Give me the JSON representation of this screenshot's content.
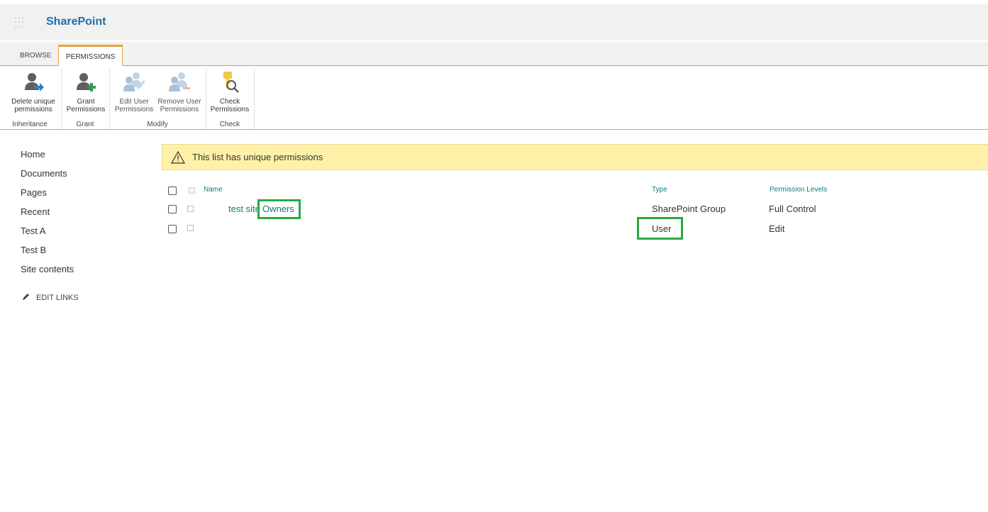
{
  "suite_bar": {
    "brand": "SharePoint",
    "app_launcher_icon": "waffle-icon"
  },
  "ribbon": {
    "tabs": [
      {
        "label": "BROWSE",
        "selected": false
      },
      {
        "label": "PERMISSIONS",
        "selected": true
      }
    ],
    "buttons": {
      "delete_unique": {
        "line1": "Delete unique",
        "line2": "permissions",
        "icon": "user-arrow-icon"
      },
      "grant": {
        "line1": "Grant",
        "line2": "Permissions",
        "icon": "user-add-icon"
      },
      "edit_user": {
        "line1": "Edit User",
        "line2": "Permissions",
        "icon": "users-edit-icon"
      },
      "remove_user": {
        "line1": "Remove User",
        "line2": "Permissions",
        "icon": "users-remove-icon"
      },
      "check": {
        "line1": "Check",
        "line2": "Permissions",
        "icon": "key-magnifier-icon"
      }
    },
    "groups": {
      "inheritance": "Inheritance",
      "grant": "Grant",
      "modify": "Modify",
      "check": "Check"
    }
  },
  "left_nav": {
    "items": [
      "Home",
      "Documents",
      "Pages",
      "Recent",
      "Test A",
      "Test B",
      "Site contents"
    ],
    "edit_links": "EDIT LINKS"
  },
  "banner": {
    "message": "This list has unique permissions",
    "icon": "warning-icon"
  },
  "list": {
    "columns": {
      "name": "Name",
      "type": "Type",
      "levels": "Permission Levels"
    },
    "rows": [
      {
        "name_part1": "test site",
        "name_part2": "Owners",
        "type": "SharePoint Group",
        "level": "Full Control"
      },
      {
        "name_part1": "",
        "name_part2": "",
        "type": "User",
        "level": "Edit"
      }
    ]
  },
  "colors": {
    "accent": "#e8a13a",
    "brand": "#1f6fab",
    "link": "#0f7a7a",
    "banner": "#fff2a8",
    "highlight": "#2aa845"
  }
}
